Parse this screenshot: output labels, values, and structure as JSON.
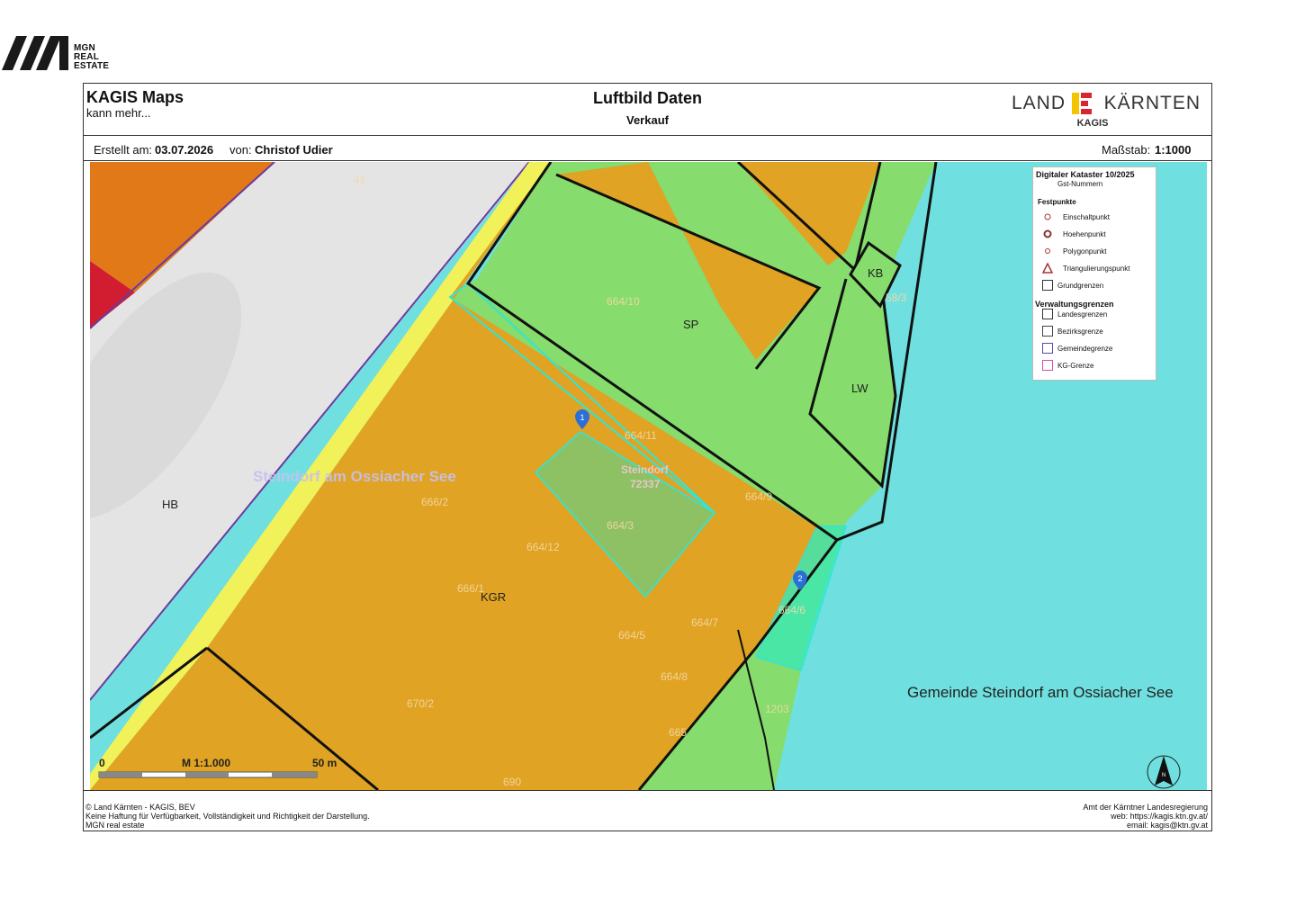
{
  "logo": {
    "line1": "MGN",
    "line2": "REAL",
    "line3": "ESTATE"
  },
  "header": {
    "brand": "KAGIS Maps",
    "brand_sub": "kann mehr...",
    "title": "Luftbild Daten",
    "subtitle": "Verkauf",
    "kagis_land": "LAND",
    "kagis_kaernten": "KÄRNTEN",
    "kagis_label": "KAGIS"
  },
  "meta": {
    "created_label": "Erstellt am:",
    "created_value": "03.07.2026",
    "by_label": "von:",
    "by_value": "Christof Udier",
    "scale_label": "Maßstab:",
    "scale_value": "1:1000"
  },
  "map": {
    "zones": {
      "hb": "HB",
      "kgr": "KGR",
      "sp": "SP",
      "kb": "KB",
      "lw": "LW"
    },
    "parcels": [
      "41",
      "664/10",
      "664/11",
      "666/2",
      "664/3",
      "664/12",
      "666/1",
      "664/5",
      "664/6",
      "664/9",
      "670/2",
      "664/8",
      "665",
      "1203",
      "690",
      "664/7",
      "58/3"
    ],
    "place_label": "Steindorf am Ossiacher See",
    "place_small": "Steindorf",
    "place_code": "72337",
    "gemeinde": "Gemeinde Steindorf am Ossiacher See",
    "markers": [
      "1",
      "2"
    ],
    "scalebar": {
      "start": "0",
      "mid": "M 1:1.000",
      "end": "50 m"
    },
    "north": "N",
    "colors": {
      "bauland": "#e0a323",
      "gewerbe": "#e27918",
      "gruen": "#86dc6c",
      "wasser": "#6fe0df",
      "strasse": "#e6e6e6",
      "gelb": "#f1f15a",
      "rot": "#d11d2f",
      "cyan": "#2fe6d6"
    }
  },
  "legend": {
    "title": "Digitaler Kataster 10/2025",
    "sub": "Gst-Nummern",
    "fest_title": "Festpunkte",
    "fest": [
      "Einschaltpunkt",
      "Hoehenpunkt",
      "Polygonpunkt",
      "Triangulierungspunkt"
    ],
    "grund": "Grundgrenzen",
    "verw_title": "Verwaltungsgrenzen",
    "verw": [
      "Landesgrenzen",
      "Bezirksgrenze",
      "Gemeindegrenze",
      "KG-Grenze"
    ]
  },
  "footer": {
    "l1": "© Land Kärnten - KAGIS, BEV",
    "l2": "Keine Haftung für Verfügbarkeit, Vollständigkeit und Richtigkeit der Darstellung.",
    "l3": "MGN real estate",
    "r1": "Amt der Kärntner Landesregierung",
    "r2": "web: https://kagis.ktn.gv.at/",
    "r3": "email: kagis@ktn.gv.at"
  }
}
